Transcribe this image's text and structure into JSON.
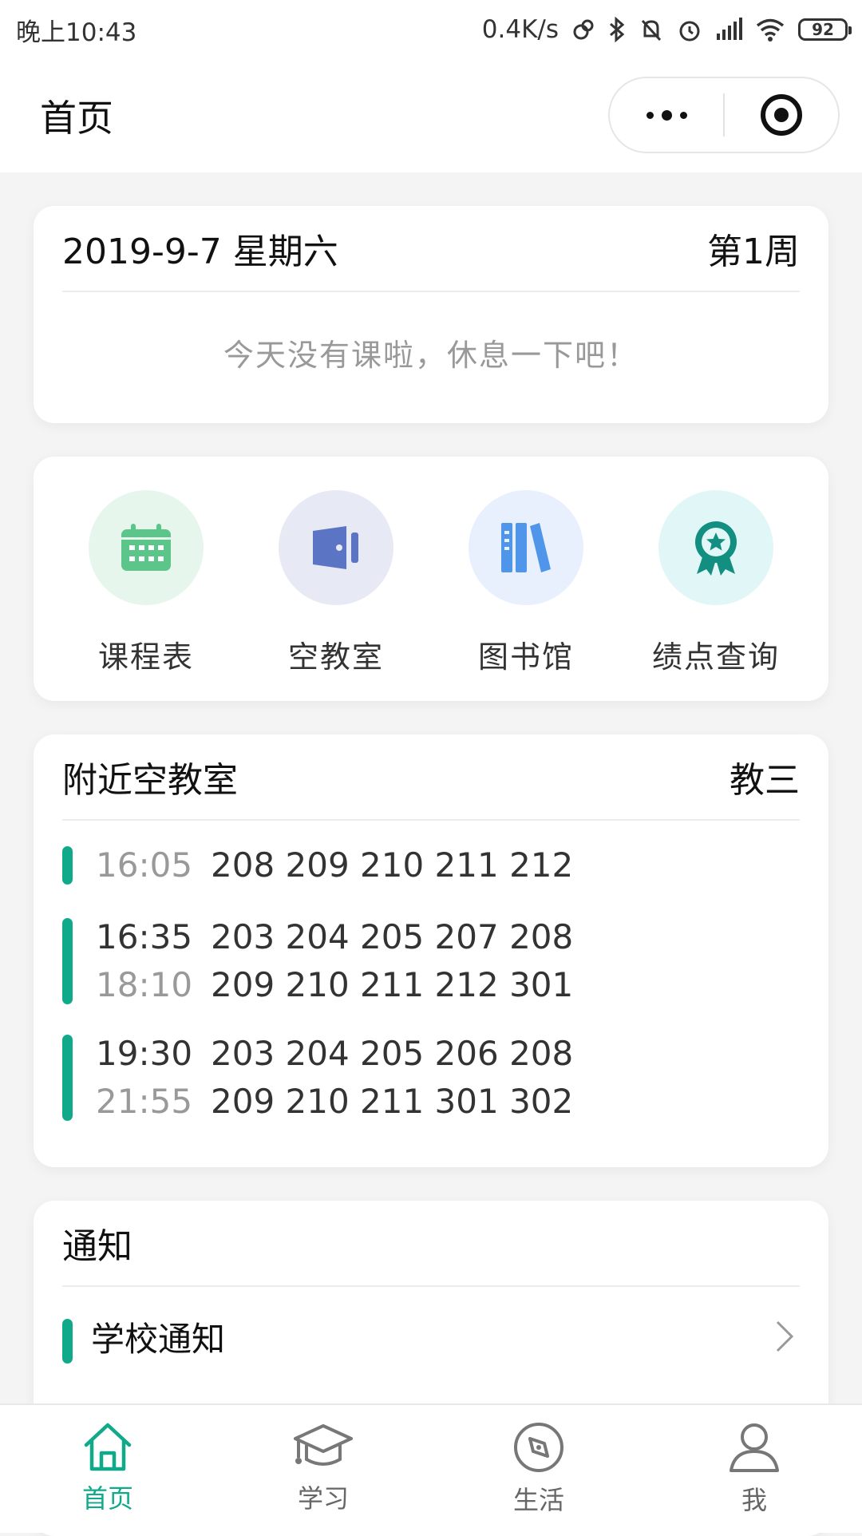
{
  "status_bar": {
    "time": "晚上10:43",
    "net_speed": "0.4K/s",
    "battery": "92"
  },
  "header": {
    "title": "首页"
  },
  "today_card": {
    "date": "2019-9-7 星期六",
    "week": "第1周",
    "message": "今天没有课啦，休息一下吧！"
  },
  "quick_links": [
    {
      "label": "课程表",
      "icon": "calendar-icon",
      "bg": "#e6f6ec",
      "color": "#5cc589"
    },
    {
      "label": "空教室",
      "icon": "door-icon",
      "bg": "#e7e9f5",
      "color": "#5b74c4"
    },
    {
      "label": "图书馆",
      "icon": "books-icon",
      "bg": "#e7f0fc",
      "color": "#4f96ea"
    },
    {
      "label": "绩点查询",
      "icon": "award-badge-icon",
      "bg": "#e1f6f6",
      "color": "#128f80"
    }
  ],
  "nearby_rooms": {
    "title": "附近空教室",
    "building": "教三",
    "slots": [
      {
        "start": "16:05",
        "end": "",
        "rooms1": "208 209 210 211 212",
        "rooms2": ""
      },
      {
        "start": "16:35",
        "end": "18:10",
        "rooms1": "203 204 205 207 208",
        "rooms2": "209 210 211 212 301"
      },
      {
        "start": "19:30",
        "end": "21:55",
        "rooms1": "203 204 205 206 208",
        "rooms2": "209 210 211 301 302"
      }
    ]
  },
  "notices": {
    "title": "通知",
    "items": [
      {
        "label": "学校通知"
      }
    ]
  },
  "tabs": [
    {
      "label": "首页",
      "icon": "home-icon",
      "active": true
    },
    {
      "label": "学习",
      "icon": "graduation-cap-icon",
      "active": false
    },
    {
      "label": "生活",
      "icon": "compass-icon",
      "active": false
    },
    {
      "label": "我",
      "icon": "user-icon",
      "active": false
    }
  ],
  "colors": {
    "accent": "#10aa8a",
    "background": "#f4f4f4"
  }
}
